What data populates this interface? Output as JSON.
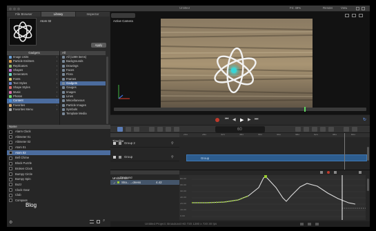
{
  "window": {
    "title": "Untitled"
  },
  "menubar": {
    "fit_label": "Fit: 48%",
    "render_label": "Render",
    "view_label": "View"
  },
  "browser": {
    "tabs": [
      {
        "label": "File Browser"
      },
      {
        "label": "Library",
        "active": true
      },
      {
        "label": "Inspector"
      }
    ],
    "preview_title": "Atom 02",
    "apply_label": "Apply",
    "column1_header": "Gadgets",
    "column2_header": "All",
    "categories": [
      {
        "label": "Image Units",
        "color": "#6aa0d8"
      },
      {
        "label": "Particle Emitters",
        "color": "#d89a4a"
      },
      {
        "label": "Replicators",
        "color": "#8fb86a"
      },
      {
        "label": "Shapes",
        "color": "#c46ad8"
      },
      {
        "label": "Generators",
        "color": "#6ad8c4"
      },
      {
        "label": "Fonts",
        "color": "#d8c46a"
      },
      {
        "label": "Text Styles",
        "color": "#6a8ad8"
      },
      {
        "label": "Shape Styles",
        "color": "#d86a6a"
      },
      {
        "label": "Music",
        "color": "#d86aa8"
      },
      {
        "label": "Photos",
        "color": "#6ad86a"
      },
      {
        "label": "Content",
        "color": "#4b8fd8",
        "selected": true
      },
      {
        "label": "Favorites",
        "color": "#d8a86a"
      },
      {
        "label": "Favorites Menu",
        "color": "#aaaaaa"
      }
    ],
    "subcategories": [
      {
        "label": "All (1389 items)"
      },
      {
        "label": "Backgrounds"
      },
      {
        "label": "Drawings"
      },
      {
        "label": "Faces"
      },
      {
        "label": "Flora"
      },
      {
        "label": "Frames"
      },
      {
        "label": "Gadgets",
        "selected": true
      },
      {
        "label": "Gauges"
      },
      {
        "label": "Images"
      },
      {
        "label": "Lines"
      },
      {
        "label": "Miscellaneous"
      },
      {
        "label": "Particle Images"
      },
      {
        "label": "Symbols"
      },
      {
        "label": "Template Media"
      }
    ],
    "list_header": "Name",
    "items": [
      {
        "label": "Alarm Clock"
      },
      {
        "label": "Altimeter 01"
      },
      {
        "label": "Altimeter 02"
      },
      {
        "label": "Atom 01"
      },
      {
        "label": "Atom 02",
        "selected": true
      },
      {
        "label": "Bell Chime"
      },
      {
        "label": "Block Puzzle"
      },
      {
        "label": "Broken Clock"
      },
      {
        "label": "Bumpy Circle"
      },
      {
        "label": "Bumpy Spin"
      },
      {
        "label": "Buzz"
      },
      {
        "label": "Clock Gear"
      },
      {
        "label": "Club"
      },
      {
        "label": "Compass"
      }
    ],
    "watermark": "Blog"
  },
  "viewer": {
    "camera_label": "Active Camera"
  },
  "transport": {
    "timecode": "60"
  },
  "timeline": {
    "header_label": "Timeline",
    "rows": [
      {
        "label": "Group 2"
      },
      {
        "label": "Group"
      }
    ],
    "clip_label": "Group",
    "ruler_labels": [
      "241",
      "281",
      "321",
      "361",
      "401",
      "441",
      "481",
      "521",
      "561",
      "601"
    ]
  },
  "keyframes": {
    "header_label": "Untitled Set",
    "rows": [
      {
        "label": "Diamond"
      },
      {
        "label": "Sha... ...dness",
        "value": "4.42"
      }
    ],
    "axis_labels": [
      "60.00",
      "50.00",
      "40.00",
      "30.00",
      "20.00",
      "10.00",
      "0.00"
    ],
    "footer_label": "Medium"
  },
  "statusbar": {
    "text": "Untitled Project: Broadcast HD 720 1280 x 720 30 fps"
  },
  "colors": {
    "selection": "#4b6c9e",
    "clip": "#2d5d8f",
    "curve": "#dcdcdc",
    "keyframe_green": "#9acd32",
    "playhead": "#ffffff"
  }
}
